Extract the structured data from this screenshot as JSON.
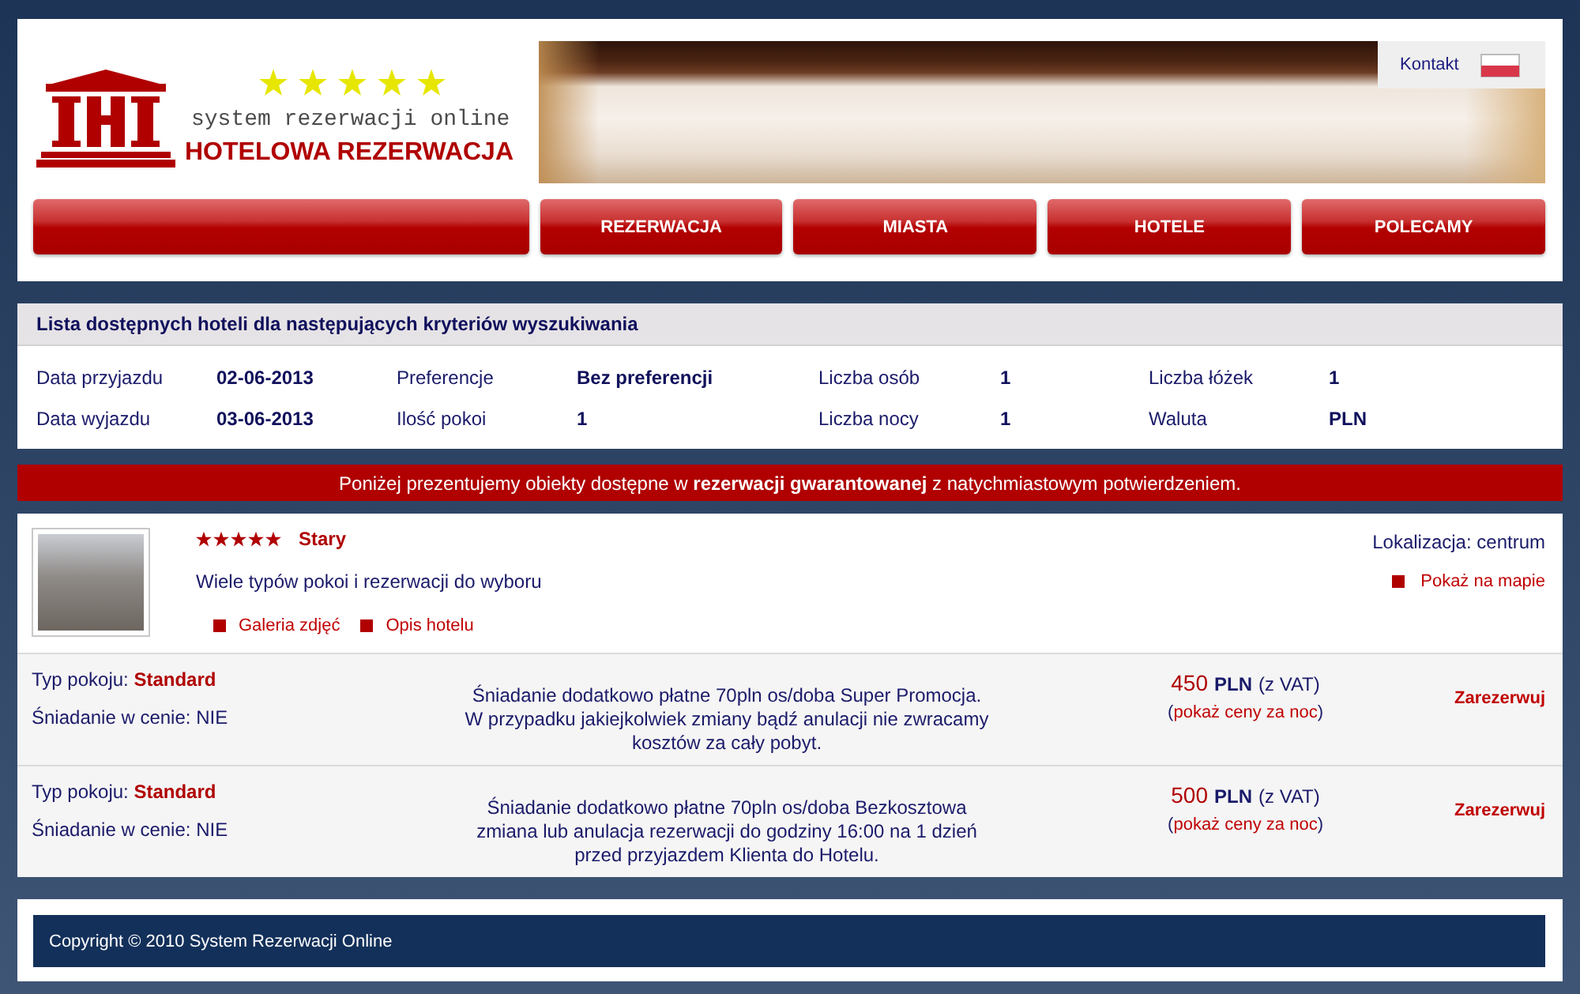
{
  "header": {
    "logo": {
      "tagline": "system rezerwacji online",
      "title": "HOTELOWA REZERWACJA"
    },
    "contact_link": "Kontakt"
  },
  "nav": [
    "REZERWACJA",
    "MIASTA",
    "HOTELE",
    "POLECAMY"
  ],
  "search_criteria": {
    "title": "Lista dostępnych hoteli dla następujących kryteriów wyszukiwania",
    "fields": [
      {
        "label": "Data przyjazdu",
        "value": "02-06-2013"
      },
      {
        "label": "Preferencje",
        "value": "Bez preferencji"
      },
      {
        "label": "Liczba osób",
        "value": "1"
      },
      {
        "label": "Liczba łóżek",
        "value": "1"
      },
      {
        "label": "Data wyjazdu",
        "value": "03-06-2013"
      },
      {
        "label": "Ilość pokoi",
        "value": "1"
      },
      {
        "label": "Liczba nocy",
        "value": "1"
      },
      {
        "label": "Waluta",
        "value": "PLN"
      }
    ]
  },
  "notice": "Poniżej prezentujemy obiekty dostępne w **rezerwacji gwarantowanej** z natychmiastowym potwierdzeniem.",
  "hotels": [
    {
      "name": "Stary",
      "stars": 5,
      "description": "Wiele typów pokoi i rezerwacji do wyboru",
      "links": [
        "Galeria zdjęć",
        "Opis hotelu"
      ],
      "location": "Lokalizacja: centrum",
      "map_link": "Pokaż na mapie",
      "rooms": [
        {
          "type_label": "Typ pokoju:",
          "type": "Standard",
          "breakfast": "Śniadanie w cenie: NIE",
          "description": "Śniadanie dodatkowo płatne 70pln os/doba Super Promocja.\nW przypadku jakiejkolwiek zmiany bądź anulacji nie zwracamy\nkosztów za cały pobyt.",
          "price": "450",
          "currency": "PLN",
          "tax_note": "(z VAT)",
          "prices_note": {
            "prefix": "(",
            "link": "pokaż ceny za noc",
            "suffix": ")"
          },
          "book_link": "Zarezerwuj"
        },
        {
          "type_label": "Typ pokoju:",
          "type": "Standard",
          "breakfast": "Śniadanie w cenie: NIE",
          "description": "Śniadanie dodatkowo płatne 70pln os/doba Bezkosztowa\nzmiana lub anulacja rezerwacji do godziny 16:00 na 1 dzień\nprzed przyjazdem Klienta do Hotelu.",
          "price": "500",
          "currency": "PLN",
          "tax_note": "(z VAT)",
          "prices_note": {
            "prefix": "(",
            "link": "pokaż ceny za noc",
            "suffix": ")"
          },
          "book_link": "Zarezerwuj"
        }
      ]
    }
  ],
  "footer": {
    "copyright": "Copyright © 2010 System Rezerwacji Online"
  }
}
